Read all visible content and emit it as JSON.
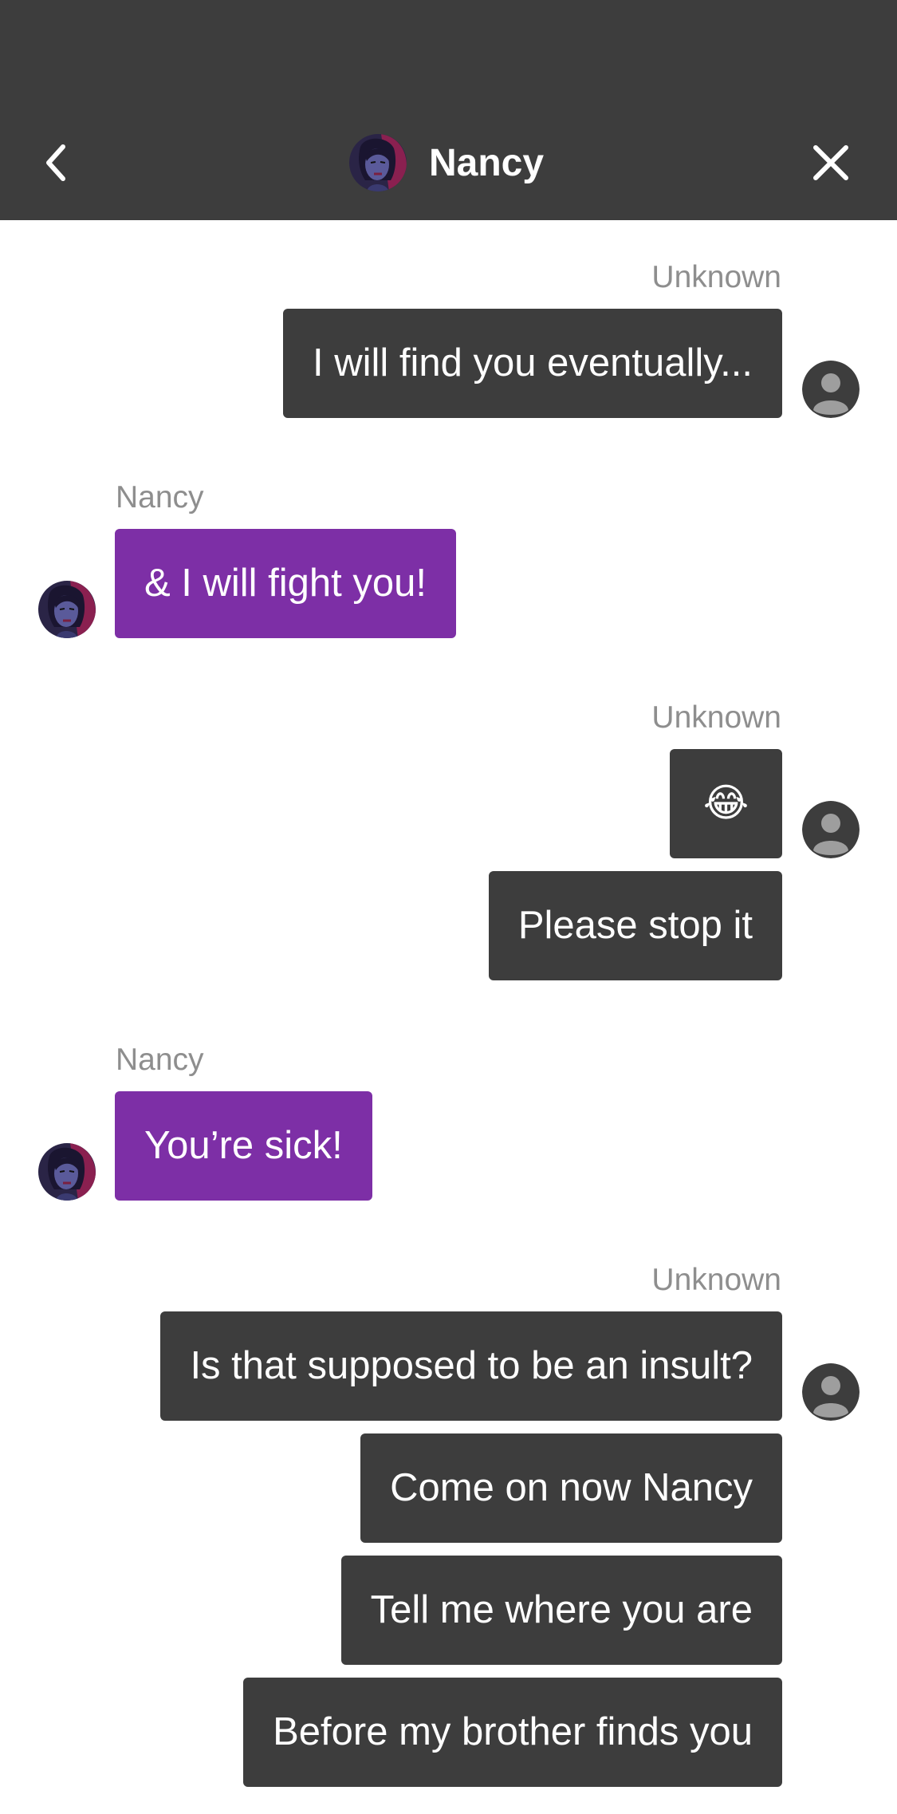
{
  "header": {
    "title": "Nancy",
    "back_icon": "chevron-left-icon",
    "close_icon": "close-icon"
  },
  "messages": [
    {
      "sender": "Unknown",
      "texts": [
        "I will find you eventually..."
      ]
    },
    {
      "sender": "Nancy",
      "texts": [
        "& I will fight you!"
      ]
    },
    {
      "sender": "Unknown",
      "texts": [
        "😂",
        "Please stop it"
      ]
    },
    {
      "sender": "Nancy",
      "texts": [
        "You’re sick!"
      ]
    },
    {
      "sender": "Unknown",
      "texts": [
        "Is that supposed to be an insult?",
        "Come on now Nancy",
        "Tell me where you are",
        "Before my brother finds you"
      ]
    }
  ],
  "colors": {
    "header_bg": "#3d3d3d",
    "outgoing_bubble": "#3d3d3d",
    "incoming_bubble": "#7d2fa6",
    "sender_label": "#8e8e8e"
  }
}
